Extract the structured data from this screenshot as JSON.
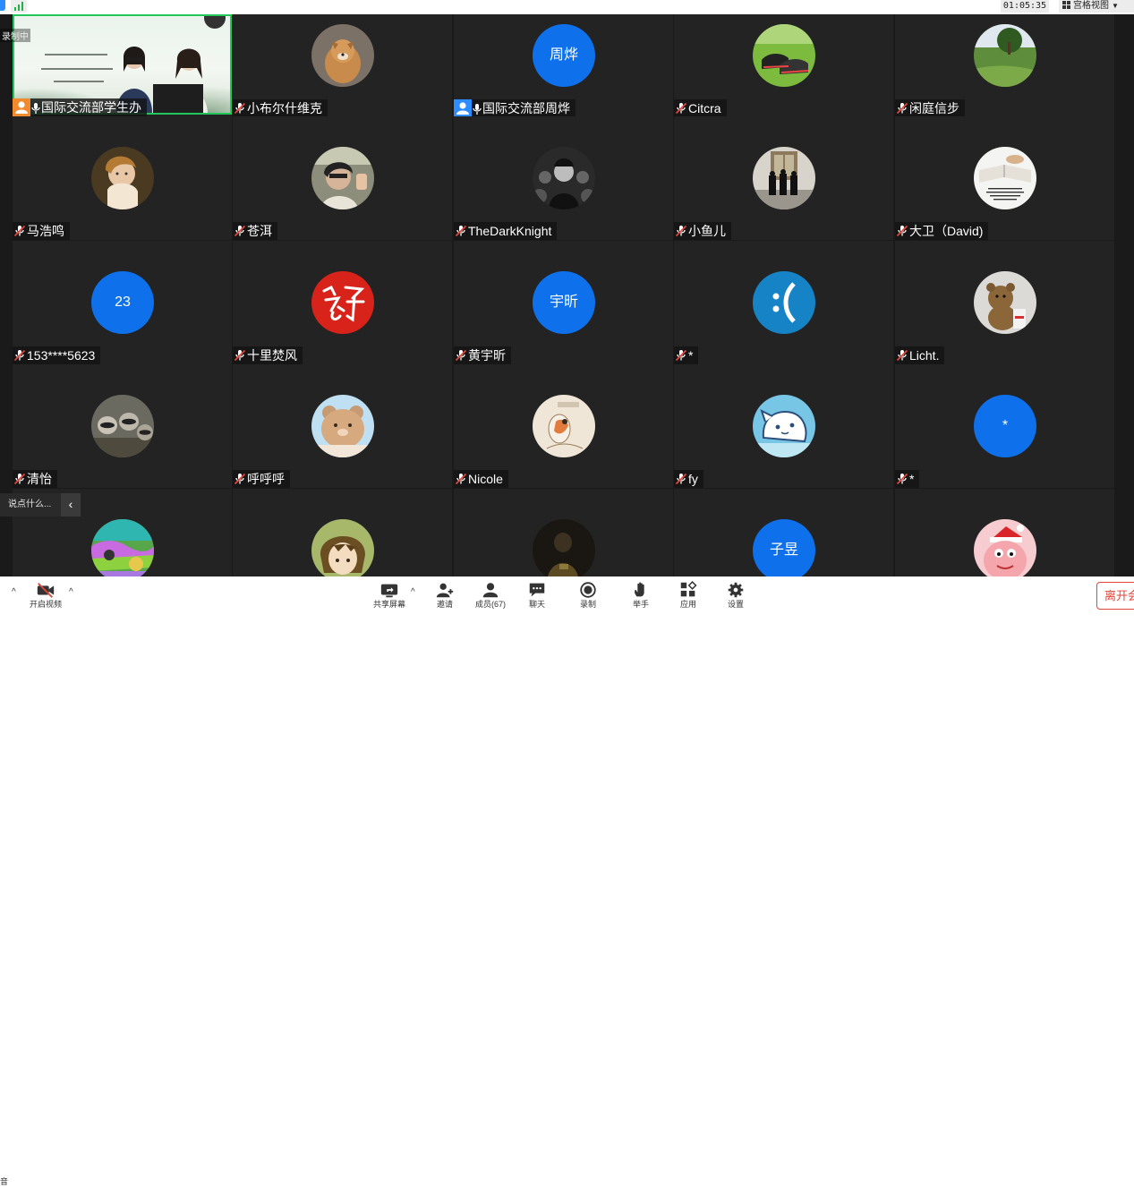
{
  "topbar": {
    "timer": "01:05:35",
    "view_label": "宫格视图"
  },
  "recording_label": "录制中",
  "participants": [
    {
      "name": "国际交流部学生办",
      "kind": "share",
      "muted": false,
      "host": true
    },
    {
      "name": "小布尔什维克",
      "kind": "photo",
      "muted": true,
      "photo": "dog"
    },
    {
      "name": "国际交流部周烨",
      "kind": "text",
      "avatar_text": "周烨",
      "muted": false,
      "host": true
    },
    {
      "name": "Citcra",
      "kind": "photo",
      "muted": true,
      "photo": "shoes"
    },
    {
      "name": "闲庭信步",
      "kind": "photo",
      "muted": true,
      "photo": "meadow"
    },
    {
      "name": "马浩鸣",
      "kind": "photo",
      "muted": true,
      "photo": "painting"
    },
    {
      "name": "苍洱",
      "kind": "photo",
      "muted": true,
      "photo": "selfie"
    },
    {
      "name": "TheDarkKnight",
      "kind": "photo",
      "muted": true,
      "photo": "bw-crowd"
    },
    {
      "name": "小鱼儿",
      "kind": "photo",
      "muted": true,
      "photo": "group"
    },
    {
      "name": "大卫（David)",
      "kind": "photo",
      "muted": true,
      "photo": "bible"
    },
    {
      "name": "153****5623",
      "kind": "text",
      "avatar_text": "23",
      "muted": true
    },
    {
      "name": "十里焚风",
      "kind": "photo",
      "muted": true,
      "photo": "red-logo"
    },
    {
      "name": "黄宇昕",
      "kind": "text",
      "avatar_text": "宇昕",
      "muted": true
    },
    {
      "name": "*",
      "kind": "photo",
      "muted": true,
      "photo": "sad-face"
    },
    {
      "name": "Licht.",
      "kind": "photo",
      "muted": true,
      "photo": "teddy"
    },
    {
      "name": "清怡",
      "kind": "photo",
      "muted": true,
      "photo": "raccoons"
    },
    {
      "name": "呼呼呼",
      "kind": "photo",
      "muted": true,
      "photo": "bear"
    },
    {
      "name": "Nicole",
      "kind": "photo",
      "muted": true,
      "photo": "sketch-girl"
    },
    {
      "name": "fy",
      "kind": "photo",
      "muted": true,
      "photo": "cat-cartoon"
    },
    {
      "name": "*",
      "kind": "text",
      "avatar_text": "*",
      "muted": true
    },
    {
      "name": "",
      "kind": "photo",
      "muted": true,
      "photo": "colorful"
    },
    {
      "name": "",
      "kind": "photo",
      "muted": true,
      "photo": "anime"
    },
    {
      "name": "",
      "kind": "photo",
      "muted": true,
      "photo": "dark-room"
    },
    {
      "name": "",
      "kind": "text",
      "avatar_text": "子昱",
      "muted": true
    },
    {
      "name": "",
      "kind": "photo",
      "muted": true,
      "photo": "patrick"
    }
  ],
  "comment_box": {
    "placeholder": "说点什么..."
  },
  "toolbar": {
    "left_cut": "音",
    "video_label": "开启视频",
    "share_label": "共享屏幕",
    "invite_label": "邀请",
    "members_label": "成员(67)",
    "chat_label": "聊天",
    "record_label": "录制",
    "raise_label": "举手",
    "apps_label": "应用",
    "settings_label": "设置",
    "leave_label": "离开会"
  },
  "colors": {
    "accent": "#0e71eb",
    "speaker_border": "#23c65b",
    "leave": "#e0463a"
  }
}
